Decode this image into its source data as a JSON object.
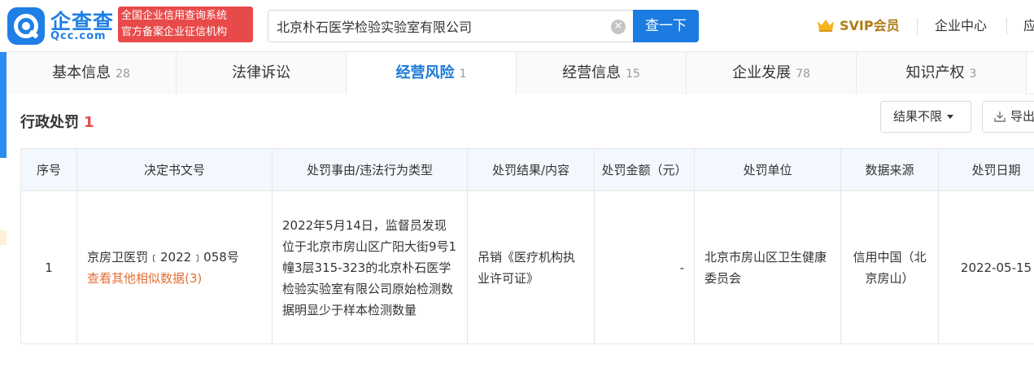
{
  "header": {
    "logo_name": "企查查",
    "logo_url": "Qcc.com",
    "slogan_line1": "全国企业信用查询系统",
    "slogan_line2": "官方备案企业征信机构",
    "search_value": "北京朴石医学检验实验室有限公司",
    "search_button": "查一下",
    "svip": "SVIP会员",
    "enterprise_center": "企业中心",
    "truncated_link": "应"
  },
  "tabs": [
    {
      "label": "基本信息",
      "count": "28"
    },
    {
      "label": "法律诉讼",
      "count": ""
    },
    {
      "label": "经营风险",
      "count": "1"
    },
    {
      "label": "经营信息",
      "count": "15"
    },
    {
      "label": "企业发展",
      "count": "78"
    },
    {
      "label": "知识产权",
      "count": "3"
    }
  ],
  "section": {
    "title": "行政处罚",
    "count": "1",
    "filter_label": "结果不限",
    "export_label": "导出"
  },
  "table": {
    "headers": [
      "序号",
      "决定书文号",
      "处罚事由/违法行为类型",
      "处罚结果/内容",
      "处罚金额（元）",
      "处罚单位",
      "数据来源",
      "处罚日期"
    ],
    "rows": [
      {
        "index": "1",
        "doc_no": "京房卫医罚﹝2022﹞058号",
        "similar_link": "查看其他相似数据(3)",
        "reason": "2022年5月14日，监督员发现位于北京市房山区广阳大街9号1幢3层315-323的北京朴石医学检验实验室有限公司原始检测数据明显少于样本检测数量",
        "result": "吊销《医疗机构执业许可证》",
        "amount": "-",
        "unit": "北京市房山区卫生健康委员会",
        "source": "信用中国（北京房山）",
        "date": "2022-05-15"
      }
    ]
  },
  "colors": {
    "brand": "#1f7fe6",
    "active_tab": "#1a7ad6",
    "count_red": "#e84a4a",
    "link_orange": "#e26e34",
    "header_bg": "#f2f8fe"
  }
}
